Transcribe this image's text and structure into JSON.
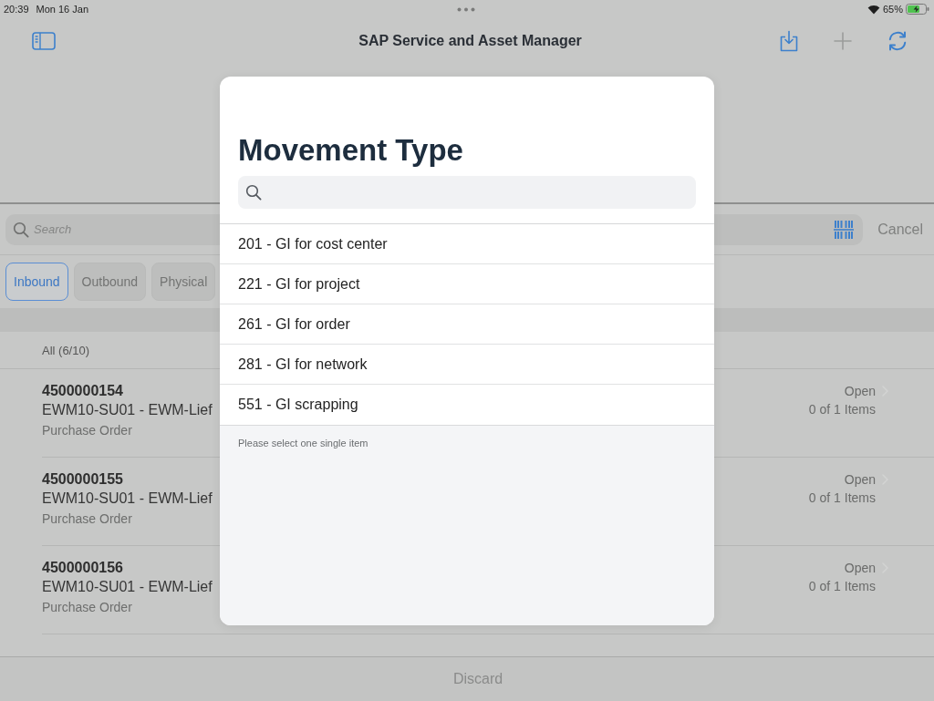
{
  "status_bar": {
    "time": "20:39",
    "date": "Mon 16 Jan",
    "battery": "65%"
  },
  "nav_bar": {
    "title": "SAP Service and Asset Manager",
    "actions": [
      {
        "kind": "download",
        "disabled": false
      },
      {
        "kind": "add",
        "disabled": true
      },
      {
        "kind": "sync",
        "disabled": false
      }
    ]
  },
  "search": {
    "placeholder": "Search",
    "cancel": "Cancel"
  },
  "filters": [
    {
      "label": "Inbound",
      "selected": true
    },
    {
      "label": "Outbound",
      "selected": false
    },
    {
      "label": "Physical",
      "selected": false
    }
  ],
  "list": {
    "header": "All (6/10)",
    "rows": [
      {
        "number": "4500000154",
        "title": "EWM10-SU01 - EWM-Lief",
        "type": "Purchase Order",
        "status": "Open",
        "items": "0 of 1 Items"
      },
      {
        "number": "4500000155",
        "title": "EWM10-SU01 - EWM-Lief",
        "type": "Purchase Order",
        "status": "Open",
        "items": "0 of 1 Items"
      },
      {
        "number": "4500000156",
        "title": "EWM10-SU01 - EWM-Lief",
        "type": "Purchase Order",
        "status": "Open",
        "items": "0 of 1 Items"
      }
    ]
  },
  "toolbar": {
    "discard": "Discard"
  },
  "dialog": {
    "title": "Movement Type",
    "options": [
      {
        "label": "201 - GI for cost center",
        "selected": false
      },
      {
        "label": "221 - GI for project",
        "selected": false
      },
      {
        "label": "261 - GI for order",
        "selected": false
      },
      {
        "label": "281 - GI for network",
        "selected": false
      },
      {
        "label": "551 - GI scrapping",
        "selected": false
      }
    ],
    "hint": "Please select one single item"
  }
}
